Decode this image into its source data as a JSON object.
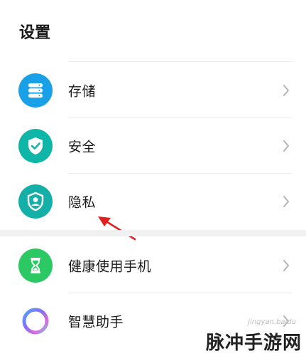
{
  "header": {
    "title": "设置"
  },
  "items": [
    {
      "label": "存储",
      "icon": "storage-icon",
      "color": "#1aa0e6"
    },
    {
      "label": "安全",
      "icon": "shield-check-icon",
      "color": "#0fb6a8"
    },
    {
      "label": "隐私",
      "icon": "privacy-shield-icon",
      "color": "#14b0a8"
    },
    {
      "label": "健康使用手机",
      "icon": "hourglass-icon",
      "color": "#2cc864"
    },
    {
      "label": "智慧助手",
      "icon": "assistant-ring-icon",
      "color": "#7a6cf0"
    }
  ],
  "watermark": {
    "text": "脉冲手游网",
    "sub": "jingyan.baidu"
  },
  "annotation": {
    "arrow_color": "#e02020"
  }
}
